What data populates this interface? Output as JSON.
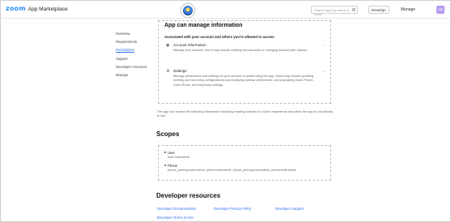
{
  "header": {
    "brand": "zoom",
    "product": "App Marketplace",
    "search_placeholder": "Search apps by name or more",
    "develop_label": "Develop",
    "manage_label": "Manage",
    "avatar_initials": "CE"
  },
  "nav": {
    "items": [
      {
        "label": "Overview",
        "active": false
      },
      {
        "label": "Requirements",
        "active": false
      },
      {
        "label": "Permissions",
        "active": true
      },
      {
        "label": "Support",
        "active": false
      },
      {
        "label": "Developer resources",
        "active": false
      },
      {
        "label": "Manage",
        "active": false
      }
    ]
  },
  "manage_info": {
    "title": "App can manage information",
    "subtitle": "Associated with your account and others you're allowed to access",
    "permissions": [
      {
        "title": "Account information",
        "description": "Manage your account, who it may include creating sub-accounts or changing account plan options.",
        "icon": "account-icon"
      },
      {
        "title": "Settings",
        "description": "Manage preferences and settings on your account or profile using the app, which may include updating meeting and recording configurations and modifying webinar preferences, and populating Zoom Phone, Zoom Room, and telephony settings.",
        "icon": "settings-icon"
      }
    ]
  },
  "access_note": "The app can access the following information including reading outside of a Zoom experience and when the app is not actively in use.",
  "scopes": {
    "heading": "Scopes",
    "items": [
      {
        "name": "User",
        "value": "user:read:admin"
      },
      {
        "name": "Phone",
        "value": "phone_peering:write:admin, phone:read:admin, phone_peering:read:admin, phone:write:admin"
      }
    ]
  },
  "developer_resources": {
    "heading": "Developer resources",
    "links": [
      "Developer Documentation",
      "Developer Privacy Policy",
      "Developer Support",
      "Developer Terms of Use"
    ]
  }
}
